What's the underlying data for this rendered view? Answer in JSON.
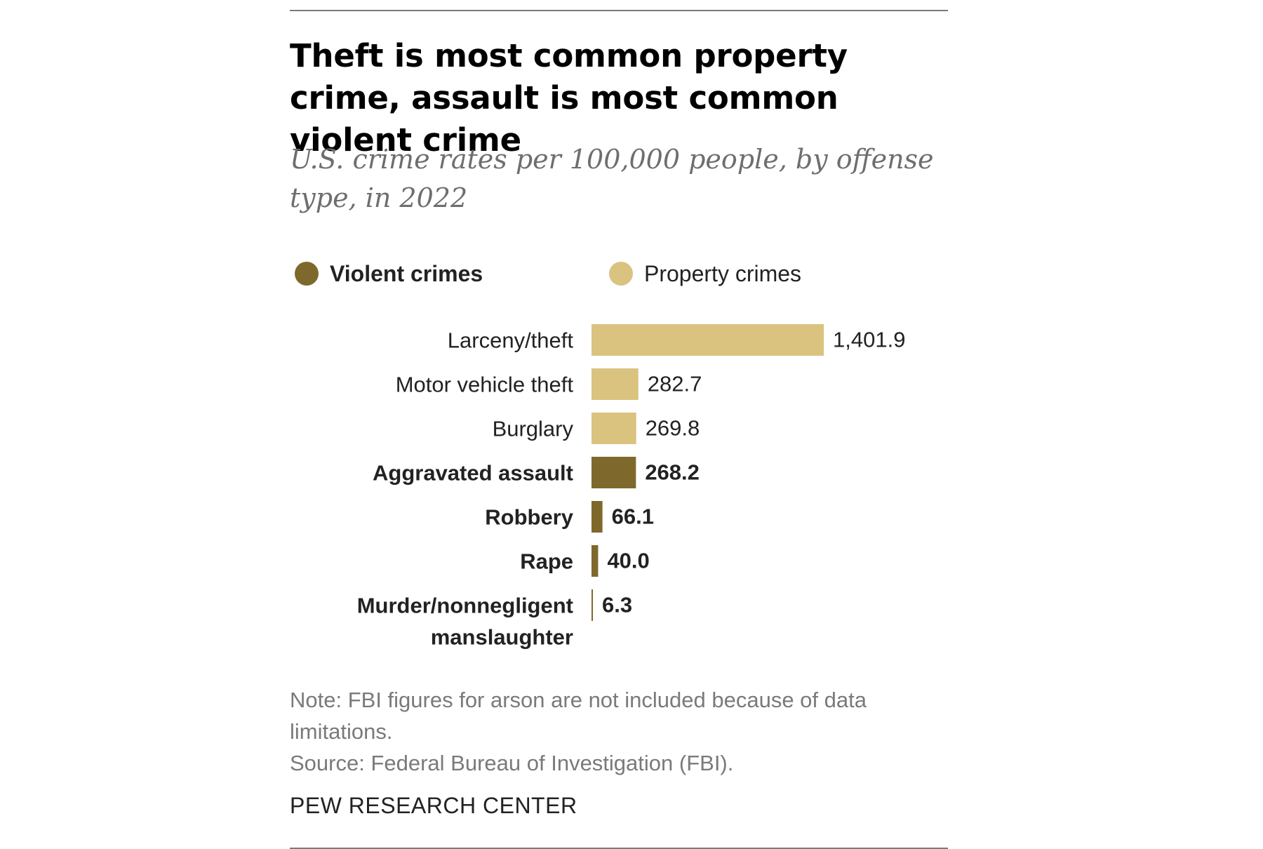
{
  "title": "Theft is most common property crime, assault is most common violent crime",
  "subtitle": "U.S. crime rates per 100,000 people, by offense type, in 2022",
  "legend": {
    "violent": {
      "label": "Violent crimes",
      "color": "#7f682b"
    },
    "property": {
      "label": "Property crimes",
      "color": "#d9c37f"
    }
  },
  "chart_data": {
    "type": "bar",
    "orientation": "horizontal",
    "title": "Theft is most common property crime, assault is most common violent crime",
    "subtitle": "U.S. crime rates per 100,000 people, by offense type, in 2022",
    "xlim": [
      0,
      1401.9
    ],
    "grid": false,
    "legend_position": "top",
    "series": [
      {
        "name": "Violent crimes",
        "color": "#7f682b"
      },
      {
        "name": "Property crimes",
        "color": "#d9c37f"
      }
    ],
    "categories": [
      "Larceny/theft",
      "Motor vehicle theft",
      "Burglary",
      "Aggravated assault",
      "Robbery",
      "Rape",
      "Murder/nonnegligent manslaughter"
    ],
    "category_lines": [
      [
        "Larceny/theft"
      ],
      [
        "Motor vehicle theft"
      ],
      [
        "Burglary"
      ],
      [
        "Aggravated assault"
      ],
      [
        "Robbery"
      ],
      [
        "Rape"
      ],
      [
        "Murder/nonnegligent",
        "manslaughter"
      ]
    ],
    "values": [
      1401.9,
      282.7,
      269.8,
      268.2,
      66.1,
      40.0,
      6.3
    ],
    "value_labels": [
      "1,401.9",
      "282.7",
      "269.8",
      "268.2",
      "66.1",
      "40.0",
      "6.3"
    ],
    "groups": [
      "Property crimes",
      "Property crimes",
      "Property crimes",
      "Violent crimes",
      "Violent crimes",
      "Violent crimes",
      "Violent crimes"
    ]
  },
  "note": "Note: FBI figures for arson are not included because of data limitations.",
  "source": "Source: Federal Bureau of Investigation (FBI).",
  "brand": "PEW RESEARCH CENTER"
}
